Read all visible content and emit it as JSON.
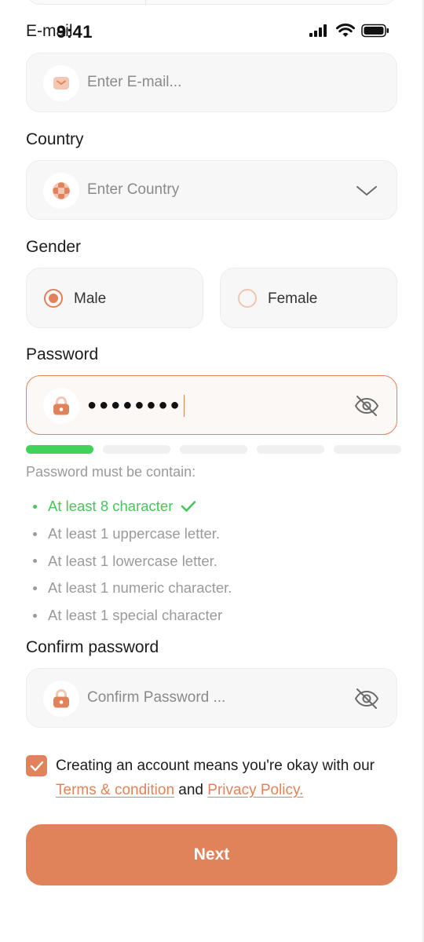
{
  "status_bar": {
    "time": "9:41"
  },
  "form": {
    "email": {
      "label": "E-mail",
      "placeholder": "Enter E-mail..."
    },
    "country": {
      "label": "Country",
      "placeholder": "Enter Country"
    },
    "gender": {
      "label": "Gender",
      "options": [
        {
          "label": "Male",
          "selected": true
        },
        {
          "label": "Female",
          "selected": false
        }
      ]
    },
    "password": {
      "label": "Password",
      "value": "●●●●●●●●",
      "strength_segments_filled": 1,
      "strength_segments_total": 5
    },
    "requirements": {
      "title": "Password must be contain:",
      "items": [
        {
          "text": "At least 8 character",
          "met": true
        },
        {
          "text": "At least 1 uppercase letter.",
          "met": false
        },
        {
          "text": "At least 1 lowercase letter.",
          "met": false
        },
        {
          "text": "At least 1 numeric character.",
          "met": false
        },
        {
          "text": "At least 1 special character",
          "met": false
        }
      ]
    },
    "confirm_password": {
      "label": "Confirm password",
      "placeholder": "Confirm Password ..."
    },
    "terms": {
      "checked": true,
      "text_before": "Creating an account means you're okay with our ",
      "terms_link": "Terms & condition",
      "text_middle": " and ",
      "privacy_link": "Privacy Policy."
    },
    "next_label": "Next"
  },
  "colors": {
    "accent": "#e0825a",
    "success": "#45c65a",
    "field_bg": "#f7f7f7"
  },
  "icons": [
    "envelope-icon",
    "globe-icon",
    "chevron-down-icon",
    "lock-icon",
    "eye-off-icon",
    "check-icon",
    "signal-icon",
    "wifi-icon",
    "battery-icon"
  ]
}
